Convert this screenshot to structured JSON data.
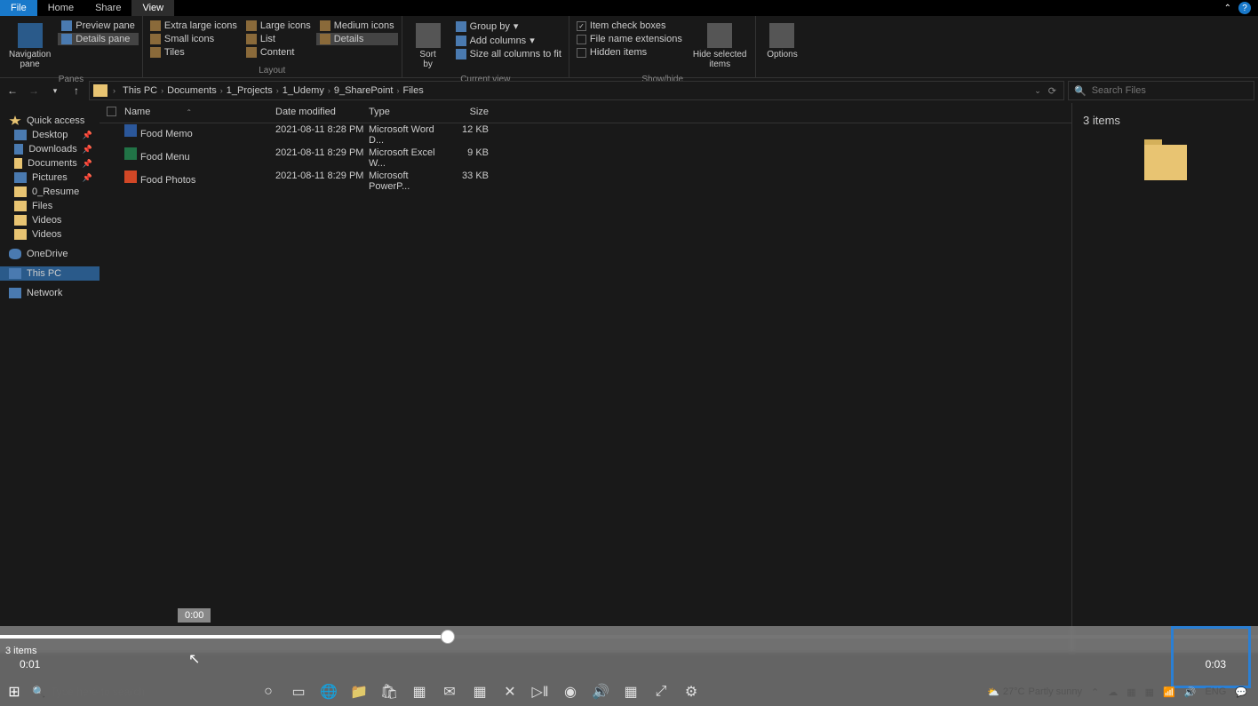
{
  "tabs": {
    "file": "File",
    "home": "Home",
    "share": "Share",
    "view": "View"
  },
  "ribbon": {
    "panes": {
      "navigation": "Navigation\npane",
      "preview": "Preview pane",
      "details": "Details pane",
      "label": "Panes"
    },
    "layout": {
      "extra_large": "Extra large icons",
      "large": "Large icons",
      "medium": "Medium icons",
      "small": "Small icons",
      "list": "List",
      "details": "Details",
      "tiles": "Tiles",
      "content": "Content",
      "label": "Layout"
    },
    "current": {
      "sort": "Sort\nby",
      "group": "Group by",
      "add_cols": "Add columns",
      "size_cols": "Size all columns to fit",
      "label": "Current view"
    },
    "showhide": {
      "item_check": "Item check boxes",
      "file_ext": "File name extensions",
      "hidden": "Hidden items",
      "hide_sel": "Hide selected\nitems",
      "label": "Show/hide"
    },
    "options": "Options"
  },
  "breadcrumbs": [
    "This PC",
    "Documents",
    "1_Projects",
    "1_Udemy",
    "9_SharePoint",
    "Files"
  ],
  "search_placeholder": "Search Files",
  "sidebar": {
    "quick": "Quick access",
    "desktop": "Desktop",
    "downloads": "Downloads",
    "documents": "Documents",
    "pictures": "Pictures",
    "resume": "0_Resume",
    "files": "Files",
    "videos1": "Videos",
    "videos2": "Videos",
    "onedrive": "OneDrive",
    "thispc": "This PC",
    "network": "Network"
  },
  "columns": {
    "name": "Name",
    "date": "Date modified",
    "type": "Type",
    "size": "Size"
  },
  "files": [
    {
      "name": "Food Memo",
      "date": "2021-08-11 8:28 PM",
      "type": "Microsoft Word D...",
      "size": "12 KB",
      "icon": "word"
    },
    {
      "name": "Food Menu",
      "date": "2021-08-11 8:29 PM",
      "type": "Microsoft Excel W...",
      "size": "9 KB",
      "icon": "excel"
    },
    {
      "name": "Food Photos",
      "date": "2021-08-11 8:29 PM",
      "type": "Microsoft PowerP...",
      "size": "33 KB",
      "icon": "ppt"
    }
  ],
  "details_pane": {
    "count": "3 items"
  },
  "status": {
    "items": "3 items"
  },
  "player": {
    "tooltip": "0:00",
    "current": "0:01",
    "duration": "0:03"
  },
  "taskbar": {
    "search": "Type here to search",
    "weather_temp": "27°C",
    "weather_text": "Partly sunny",
    "lang": "ENG"
  }
}
